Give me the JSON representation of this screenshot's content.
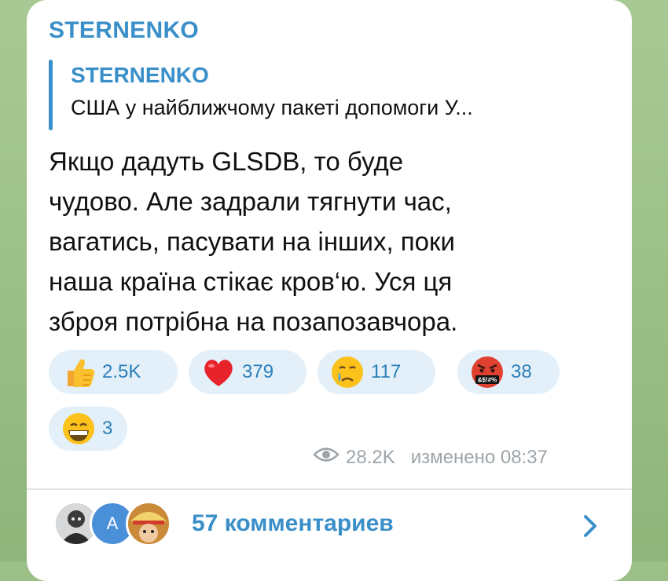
{
  "channel": {
    "name": "STERNENKO"
  },
  "reply": {
    "author": "STERNENKO",
    "preview": "США у найближчому пакеті допомоги У..."
  },
  "message": {
    "lines": [
      "Якщо дадуть GLSDB, то буде",
      "чудово. Але задрали тягнути час,",
      "вагатись, пасувати на інших, поки",
      "наша країна стікає кров‘ю. Уся ця",
      "зброя потрібна на позапозавчора."
    ]
  },
  "reactions": [
    {
      "emoji": "thumbs-up-icon",
      "count": "2.5K"
    },
    {
      "emoji": "red-heart-icon",
      "count": "379"
    },
    {
      "emoji": "crying-face-icon",
      "count": "117"
    },
    {
      "emoji": "cursing-face-icon",
      "count": "38",
      "symbols": "&$!#%"
    },
    {
      "emoji": "grinning-face-icon",
      "count": "3"
    }
  ],
  "meta": {
    "views": "28.2K",
    "edited": "изменено 08:37"
  },
  "comments": {
    "label": "57 комментариев",
    "avatar_letter": "A"
  },
  "colors": {
    "accent": "#3a8fc9",
    "reaction_bg": "#e3f0f9",
    "wallpaper": "#9bbf86"
  }
}
